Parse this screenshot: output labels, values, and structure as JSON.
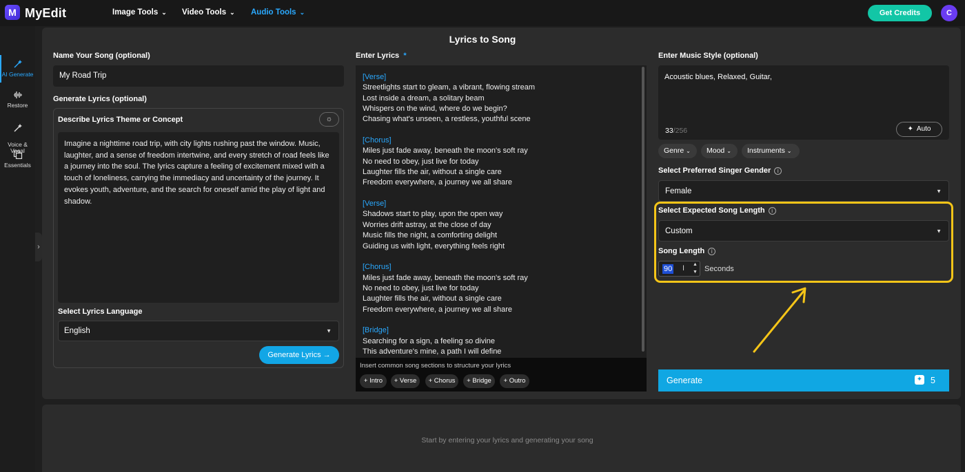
{
  "app": {
    "logo": "M",
    "name": "MyEdit"
  },
  "nav": [
    {
      "label": "Image Tools"
    },
    {
      "label": "Video Tools"
    },
    {
      "label": "Audio Tools"
    }
  ],
  "header": {
    "credits_label": "Get Credits",
    "avatar_initial": "C"
  },
  "sidebar": {
    "items": [
      {
        "label": "AI Generate",
        "icon": "magic-wand-icon"
      },
      {
        "label": "Restore",
        "icon": "waveform-icon"
      },
      {
        "label": "Voice &\nVocal",
        "icon": "magic-wand-icon"
      },
      {
        "label": "Essentials",
        "icon": "copy-icon"
      }
    ]
  },
  "page": {
    "title": "Lyrics to Song"
  },
  "song_name": {
    "label": "Name Your Song (optional)",
    "value": "My Road Trip"
  },
  "generate_lyrics": {
    "section_label": "Generate Lyrics (optional)",
    "theme_label": "Describe Lyrics Theme or Concept",
    "theme_text": "Imagine a nighttime road trip, with city lights rushing past the window. Music, laughter, and a sense of freedom intertwine, and every stretch of road feels like a journey into the soul. The lyrics capture a feeling of excitement mixed with a touch of loneliness, carrying the immediacy and uncertainty of the journey. It evokes youth, adventure, and the search for oneself amid the play of light and shadow.",
    "language_label": "Select Lyrics Language",
    "language_value": "English",
    "button_label": "Generate Lyrics"
  },
  "lyrics": {
    "label": "Enter Lyrics",
    "required_mark": "*",
    "sections": [
      {
        "name": "[Verse]",
        "lines": [
          "Streetlights start to gleam, a vibrant, flowing stream",
          "Lost inside a dream, a solitary beam",
          "Whispers on the wind, where do we begin?",
          "Chasing what's unseen, a restless, youthful scene"
        ]
      },
      {
        "name": "[Chorus]",
        "lines": [
          "Miles just fade away, beneath the moon's soft ray",
          "No need to obey, just live for today",
          "Laughter fills the air, without a single care",
          "Freedom everywhere, a journey we all share"
        ]
      },
      {
        "name": "[Verse]",
        "lines": [
          "Shadows start to play, upon the open way",
          "Worries drift astray, at the close of day",
          "Music fills the night, a comforting delight",
          "Guiding us with light, everything feels right"
        ]
      },
      {
        "name": "[Chorus]",
        "lines": [
          "Miles just fade away, beneath the moon's soft ray",
          "No need to obey, just live for today",
          "Laughter fills the air, without a single care",
          "Freedom everywhere, a journey we all share"
        ]
      },
      {
        "name": "[Bridge]",
        "lines": [
          "Searching for a sign, a feeling so divine",
          "This adventure's mine, a path I will define"
        ]
      }
    ],
    "footer_hint": "Insert common song sections to structure your lyrics",
    "chips": [
      "+ Intro",
      "+ Verse",
      "+ Chorus",
      "+ Bridge",
      "+ Outro"
    ]
  },
  "music_style": {
    "label": "Enter Music Style (optional)",
    "value": "Acoustic blues, Relaxed, Guitar,",
    "char_count": "33",
    "char_max": "/256",
    "auto_label": "Auto",
    "filters": [
      "Genre",
      "Mood",
      "Instruments"
    ]
  },
  "singer_gender": {
    "label": "Select Preferred Singer Gender",
    "value": "Female"
  },
  "song_length": {
    "label": "Select Expected Song Length",
    "value": "Custom",
    "length_label": "Song Length",
    "length_value": "90",
    "unit": "Seconds"
  },
  "generate": {
    "label": "Generate",
    "cost": "5"
  },
  "output": {
    "hint": "Start by entering your lyrics and generating your song"
  },
  "colors": {
    "accent": "#2aa9ff",
    "highlight": "#f5c518",
    "credits": "#12c6a6",
    "generate": "#10a7e3"
  }
}
